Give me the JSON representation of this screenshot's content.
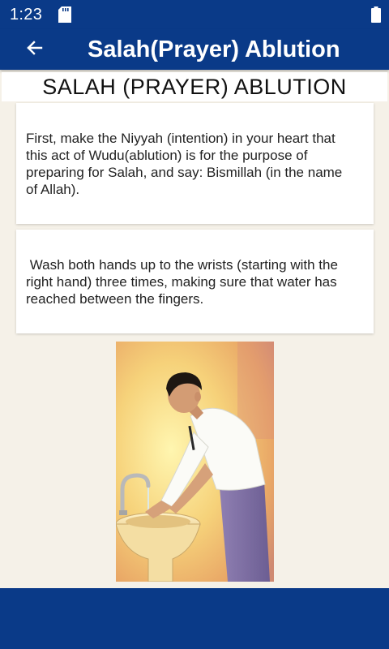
{
  "status_bar": {
    "time": "1:23",
    "icons": [
      "sd-card-icon",
      "battery-icon"
    ]
  },
  "app_bar": {
    "title": "Salah(Prayer) Ablution",
    "back_icon": "arrow-left-icon"
  },
  "page": {
    "heading": "SALAH (PRAYER) ABLUTION",
    "steps": [
      {
        "text": "First, make the Niyyah (intention) in your heart that\nthis act of Wudu(ablution) is for the purpose of\npreparing for Salah, and say: Bismillah (in the name\nof Allah)."
      },
      {
        "text": " Wash both hands up to the wrists (starting with the\nright hand) three times, making sure that water has\nreached between the fingers."
      }
    ]
  },
  "colors": {
    "primary": "#0a3a88",
    "background": "#f5f1e8",
    "card": "#ffffff"
  }
}
